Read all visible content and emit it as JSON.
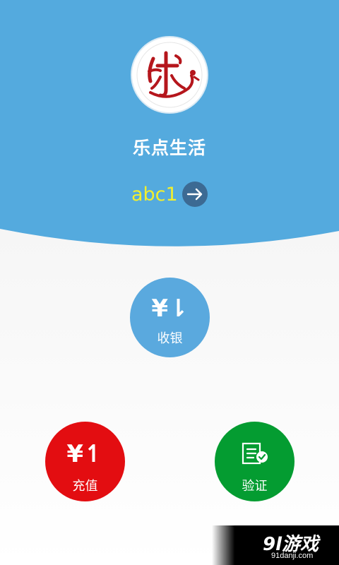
{
  "app": {
    "title": "乐点生活",
    "username": "abc1",
    "logo_glyph": "乐"
  },
  "actions": {
    "cashier": {
      "glyph": "¥⇂",
      "label": "收银"
    },
    "recharge": {
      "glyph": "¥↿",
      "label": "充值"
    },
    "verify": {
      "label": "验证"
    }
  },
  "watermark": {
    "brand": "9l游戏",
    "url": "91danji.com"
  },
  "colors": {
    "header_blue": "#54aade",
    "username_yellow": "#f2ef2d",
    "cashier_blue": "#5aa9de",
    "recharge_red": "#e30d11",
    "verify_green": "#049c31",
    "logo_red": "#b5161c"
  },
  "icons": {
    "arrow": "arrow-right-icon",
    "verify": "document-check-icon",
    "logo": "app-logo"
  }
}
